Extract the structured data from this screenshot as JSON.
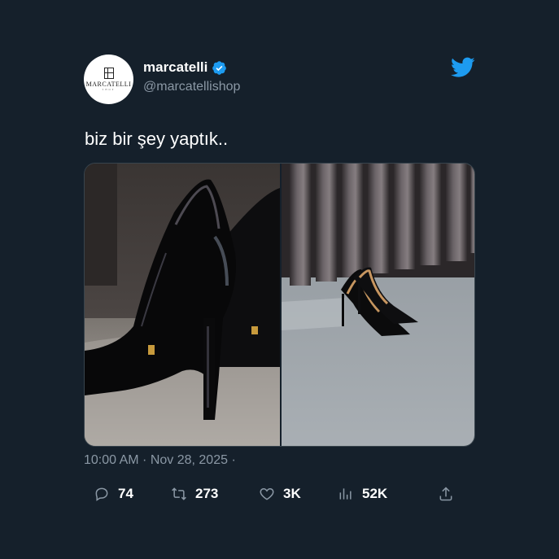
{
  "user": {
    "display_name": "marcatelli",
    "handle": "@marcatellishop",
    "verified": true,
    "avatar_text": "MARCATELLI",
    "avatar_subtext": "SHOP"
  },
  "tweet": {
    "text": "biz bir şey yaptık..",
    "timestamp": "10:00 AM · Nov 28, 2025 ·"
  },
  "media": [
    {
      "name": "close-up of black patent stiletto heel"
    },
    {
      "name": "pair of black patent stiletto pumps in front of curtain"
    }
  ],
  "stats": {
    "replies": "74",
    "retweets": "273",
    "likes": "3K",
    "views": "52K"
  },
  "icons": {
    "brand": "twitter-bird-icon",
    "verified": "verified-badge-icon",
    "reply": "reply-icon",
    "retweet": "retweet-icon",
    "like": "heart-icon",
    "views": "views-icon",
    "share": "share-icon"
  },
  "colors": {
    "background": "#15202b",
    "accent": "#1d9bf0",
    "secondary_text": "#8b98a5",
    "icon": "#8b98a5"
  }
}
